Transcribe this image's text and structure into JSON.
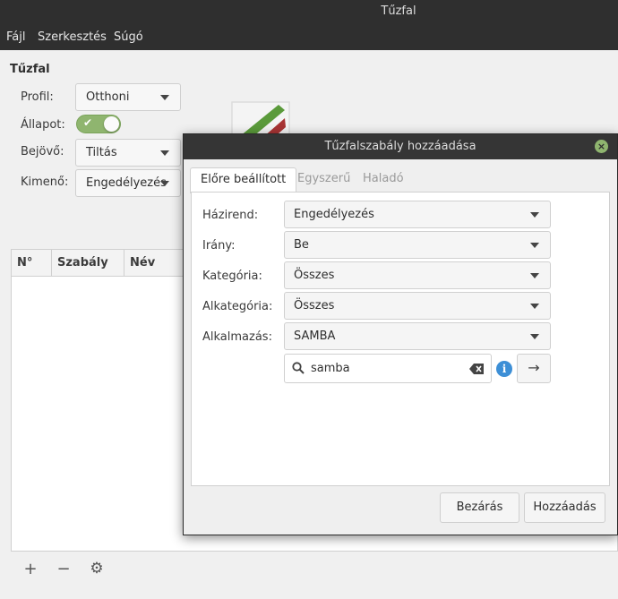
{
  "window": {
    "title": "Tűzfal"
  },
  "menu": {
    "items": [
      "Fájl",
      "Szerkesztés",
      "Súgó"
    ]
  },
  "main": {
    "section_title": "Tűzfal",
    "profile_label": "Profil:",
    "profile_value": "Otthoni",
    "status_label": "Állapot:",
    "status_on": true,
    "incoming_label": "Bejövő:",
    "incoming_value": "Tiltás",
    "outgoing_label": "Kimenő:",
    "outgoing_value": "Engedélyezés",
    "table_columns": [
      "N°",
      "Szabály",
      "Név"
    ],
    "bottom_buttons": {
      "add": "+",
      "remove": "−",
      "settings_icon": "gear-icon"
    }
  },
  "dialog": {
    "title": "Tűzfalszabály hozzáadása",
    "tabs": [
      {
        "label": "Előre beállított",
        "active": true
      },
      {
        "label": "Egyszerű",
        "active": false
      },
      {
        "label": "Haladó",
        "active": false
      }
    ],
    "fields": [
      {
        "label": "Házirend:",
        "value": "Engedélyezés"
      },
      {
        "label": "Irány:",
        "value": "Be"
      },
      {
        "label": "Kategória:",
        "value": "Összes"
      },
      {
        "label": "Alkategória:",
        "value": "Összes"
      },
      {
        "label": "Alkalmazás:",
        "value": "SAMBA"
      }
    ],
    "search_value": "samba",
    "close_button": "Bezárás",
    "add_button": "Hozzáadás"
  },
  "colors": {
    "accent_green": "#8fb56f",
    "info_blue": "#3d8fd6",
    "titlebar": "#2f2f2f"
  }
}
